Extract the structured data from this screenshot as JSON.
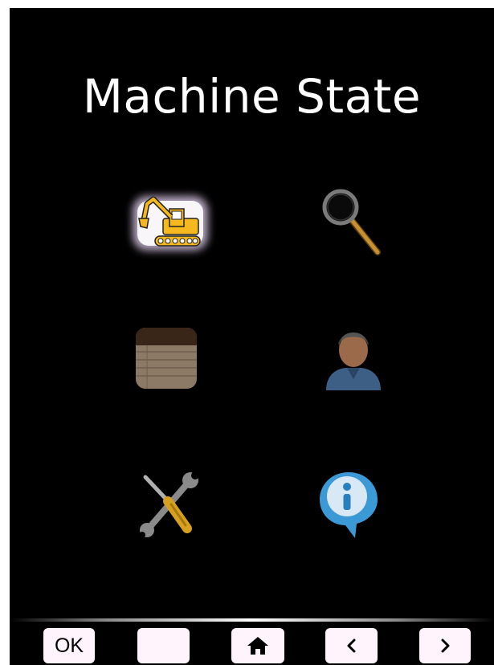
{
  "screen": {
    "title": "Machine State"
  },
  "menu": [
    {
      "name": "machine-state",
      "icon": "excavator-icon",
      "selected": true
    },
    {
      "name": "search",
      "icon": "magnifier-icon",
      "selected": false
    },
    {
      "name": "log",
      "icon": "notepad-icon",
      "selected": false
    },
    {
      "name": "user",
      "icon": "person-icon",
      "selected": false
    },
    {
      "name": "service",
      "icon": "tools-icon",
      "selected": false
    },
    {
      "name": "info",
      "icon": "info-icon",
      "selected": false
    }
  ],
  "nav": {
    "ok_label": "OK",
    "blank_label": "",
    "home_icon": "home-icon",
    "prev_icon": "chevron-left-icon",
    "next_icon": "chevron-right-icon"
  },
  "colors": {
    "background": "#000000",
    "button": "#fff4fb",
    "excavator": "#f5b81e",
    "selection_glow": "#e9c8ff",
    "info_blue": "#3b9ad6"
  }
}
